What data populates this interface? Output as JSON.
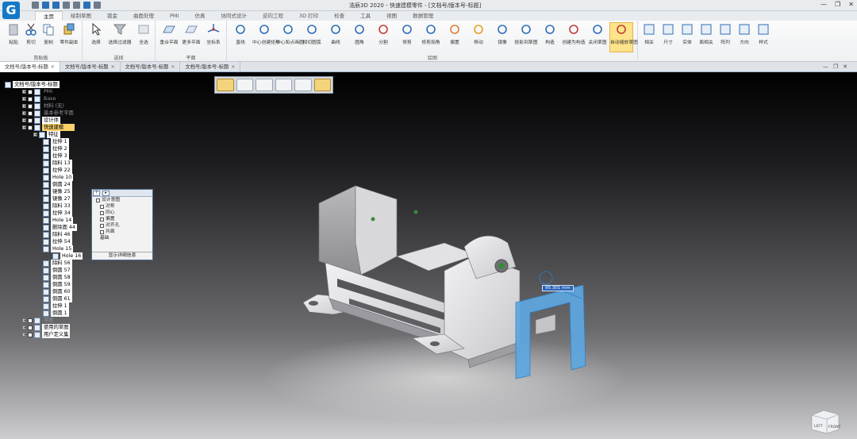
{
  "app": {
    "logo_glyph": "G",
    "title": "浩辰3D 2020 - 快速建模零件 - [文档号/版本号-标题]"
  },
  "window_controls": {
    "minimize": "—",
    "restore": "❐",
    "close": "✕",
    "help": "?"
  },
  "menu": {
    "tabs": [
      "主页",
      "绘制草图",
      "钣金",
      "曲面处理",
      "PMI",
      "仿真",
      "协同式设计",
      "逆向工程",
      "3D 打印",
      "检查",
      "工具",
      "视图",
      "数据管理"
    ],
    "active_tab": "主页"
  },
  "ribbon": {
    "clipboard": {
      "label": "剪贴板",
      "buttons": [
        "粘贴",
        "剪切",
        "复制",
        "零件副本"
      ]
    },
    "select": {
      "label": "选择",
      "buttons": [
        "选择",
        "选择过滤器",
        "全选"
      ]
    },
    "plane": {
      "label": "平面",
      "buttons": [
        "重合平面",
        "更多平面",
        "坐标系"
      ]
    },
    "draw": {
      "label": "绘图",
      "buttons": [
        "直线",
        "中心创建矩形",
        "中心和点画圆",
        "相切圆弧",
        "曲线",
        "圆角",
        "分割",
        "修剪",
        "修剪拐角",
        "偏置",
        "移动",
        "镜像",
        "投影到草图",
        "构造",
        "创建为构造",
        "关闭草图",
        "自动缩放草图"
      ]
    },
    "relate": {
      "buttons": [
        "相关",
        "尺寸",
        "实体",
        "面相关",
        "阵列",
        "方向",
        "样式"
      ]
    }
  },
  "doc_tabs": [
    "文档号/版本号-标题",
    "文档号/版本号-标题",
    "文档号/版本号-标题",
    "文档号/版本号-标题"
  ],
  "tree": {
    "root": "文档号/版本号-标题",
    "items": [
      "PMI",
      "Base",
      "材料 (无)",
      "基本参考平面",
      "设计体",
      "快速建模",
      "特征",
      "拉伸 1",
      "拉伸 2",
      "拉伸 3",
      "除料 13",
      "拉伸 22",
      "Hole 10",
      "倒圆 24",
      "镜像 25",
      "镜像 27",
      "除料 33",
      "拉伸 34",
      "Hole 14",
      "删除面 44",
      "除料 46",
      "拉伸 54",
      "Hole 15",
      "Hole 16",
      "除料 56",
      "倒圆 57",
      "倒圆 58",
      "倒圆 59",
      "倒圆 60",
      "倒圆 61",
      "拉伸 1",
      "倒圆 1",
      "草图",
      "使用的草图",
      "用户定义集"
    ]
  },
  "design_intent": {
    "items": [
      "设计意图",
      "对称",
      "同心",
      "偏置",
      "对齐孔",
      "共面",
      "基础"
    ],
    "footer": "显示详细信息"
  },
  "dimension": {
    "value": "95.301 mm"
  },
  "viewcube": {
    "left": "LEFT",
    "front": "FRONT"
  }
}
